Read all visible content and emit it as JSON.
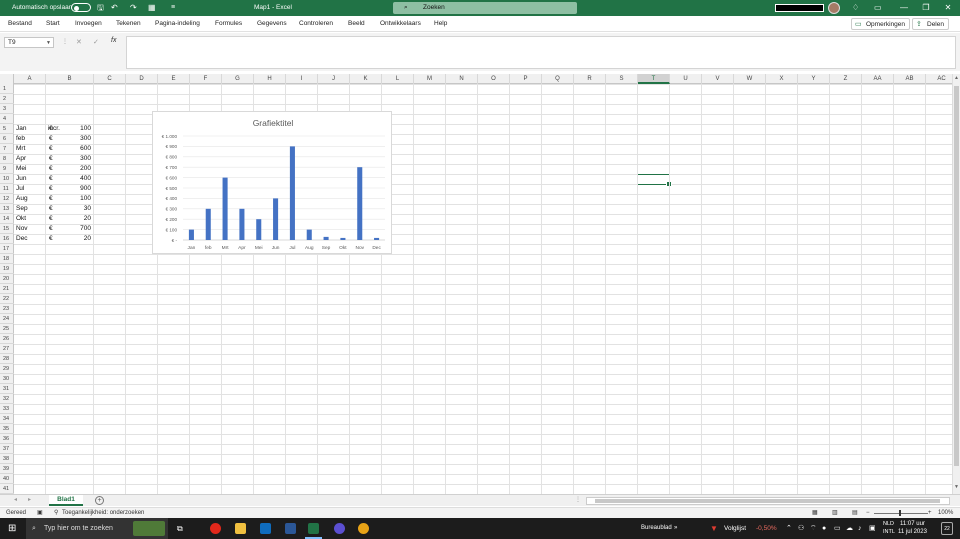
{
  "titlebar": {
    "autosave_label": "Automatisch opslaan",
    "doc_title": "Map1  -  Excel",
    "search_placeholder": "Zoeken",
    "minimize": "—",
    "restore": "❐",
    "close": "✕"
  },
  "ribbon": {
    "tabs": [
      "Bestand",
      "Start",
      "Invoegen",
      "Tekenen",
      "Pagina-indeling",
      "Formules",
      "Gegevens",
      "Controleren",
      "Beeld",
      "Ontwikkelaars",
      "Help"
    ],
    "comments_label": "Opmerkingen",
    "share_label": "Delen"
  },
  "formula_bar": {
    "name_box": "T9",
    "fx": "fx",
    "cancel": "✕",
    "confirm": "✓",
    "content": ""
  },
  "columns": [
    "A",
    "B",
    "C",
    "D",
    "E",
    "F",
    "G",
    "H",
    "I",
    "J",
    "K",
    "L",
    "M",
    "N",
    "O",
    "P",
    "Q",
    "R",
    "S",
    "T",
    "U",
    "V",
    "W",
    "X",
    "Y",
    "Z",
    "AA",
    "AB",
    "AC"
  ],
  "selected_column": "T",
  "rows": [
    "1",
    "2",
    "3",
    "4",
    "5",
    "6",
    "7",
    "8",
    "9",
    "10",
    "11",
    "12",
    "13",
    "14",
    "15",
    "16",
    "17",
    "18",
    "19",
    "20",
    "21",
    "22",
    "23",
    "24",
    "25",
    "26",
    "27",
    "28",
    "29",
    "30",
    "31",
    "32",
    "33",
    "34",
    "35",
    "36",
    "37",
    "38",
    "39",
    "40",
    "41"
  ],
  "sheet": {
    "header_b4": "incr.",
    "months": [
      "Jan",
      "feb",
      "Mrt",
      "Apr",
      "Mei",
      "Jun",
      "Jul",
      "Aug",
      "Sep",
      "Okt",
      "Nov",
      "Dec"
    ],
    "currency_symbol": "€",
    "values": [
      "100",
      "300",
      "600",
      "300",
      "200",
      "400",
      "900",
      "100",
      "30",
      "20",
      "700",
      "20"
    ]
  },
  "chart_data": {
    "type": "bar",
    "title": "Grafiektitel",
    "categories": [
      "Jan",
      "feb",
      "Mrt",
      "Apr",
      "Mei",
      "Jun",
      "Jul",
      "Aug",
      "Sep",
      "Okt",
      "Nov",
      "Dec"
    ],
    "values": [
      100,
      300,
      600,
      300,
      200,
      400,
      900,
      100,
      30,
      20,
      700,
      20
    ],
    "ylim": [
      0,
      1000
    ],
    "yticks": [
      "€ -",
      "€ 100",
      "€ 200",
      "€ 300",
      "€ 400",
      "€ 500",
      "€ 600",
      "€ 700",
      "€ 800",
      "€ 900",
      "€ 1.000"
    ],
    "xlabel": "",
    "ylabel": "",
    "grid": true,
    "bar_color": "#4472c4"
  },
  "sheet_tabs": {
    "active": "Blad1",
    "add": "+"
  },
  "status": {
    "ready": "Gereed",
    "accessibility": "Toegankelijkheid: onderzoeken",
    "zoom": "100%"
  },
  "taskbar": {
    "search_placeholder": "Typ hier om te zoeken",
    "desktop_label": "Bureaublad",
    "stock_name": "Volglijst",
    "stock_change": "-0,50%",
    "lang_top": "NLD",
    "lang_bottom": "INTL",
    "time": "11:07 uur",
    "date": "11 jul 2023",
    "notif_count": "22"
  },
  "colors": {
    "accent": "#217346",
    "taskbar": "#1c1c1c"
  }
}
